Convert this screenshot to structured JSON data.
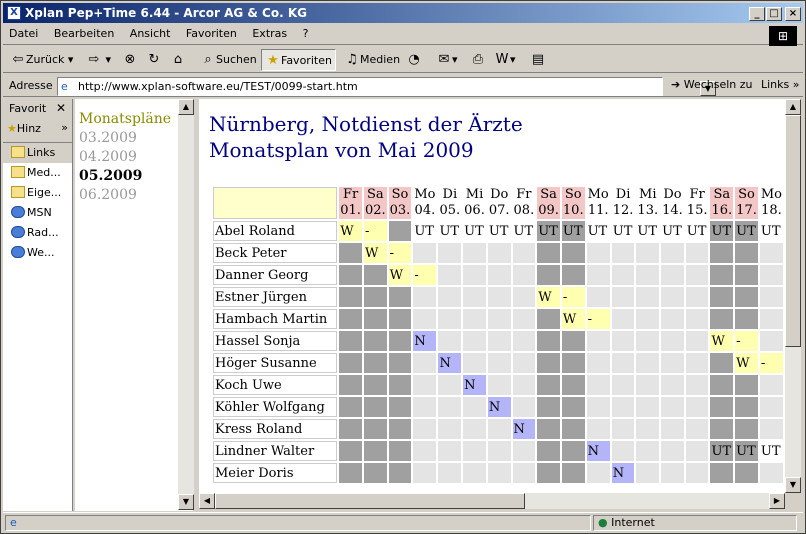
{
  "window": {
    "title": "Xplan Pep+Time 6.44 - Arcor AG & Co. KG"
  },
  "menu": [
    "Datei",
    "Bearbeiten",
    "Ansicht",
    "Favoriten",
    "Extras",
    "?"
  ],
  "toolbar": {
    "back": "Zurück",
    "search": "Suchen",
    "favorites": "Favoriten",
    "media": "Medien"
  },
  "address": {
    "label": "Adresse",
    "url": "http://www.xplan-software.eu/TEST/0099-start.htm",
    "go": "Wechseln zu",
    "links": "Links"
  },
  "favorites_pane": {
    "title": "Favorit",
    "add": "Hinz",
    "items": [
      "Links",
      "Med...",
      "Eige...",
      "MSN",
      "Rad...",
      "We..."
    ]
  },
  "left_nav": {
    "heading": "Monatspläne",
    "months": [
      "03.2009",
      "04.2009",
      "05.2009",
      "06.2009"
    ],
    "current": "05.2009"
  },
  "page": {
    "title_line1": "Nürnberg, Notdienst der Ärzte",
    "title_line2": "Monatsplan von Mai 2009"
  },
  "plan": {
    "weekdays": [
      "Fr",
      "Sa",
      "So",
      "Mo",
      "Di",
      "Mi",
      "Do",
      "Fr",
      "Sa",
      "So",
      "Mo",
      "Di",
      "Mi",
      "Do",
      "Fr",
      "Sa",
      "So",
      "Mo"
    ],
    "dates": [
      "01.",
      "02.",
      "03.",
      "04.",
      "05.",
      "06.",
      "07.",
      "08.",
      "09.",
      "10.",
      "11.",
      "12.",
      "13.",
      "14.",
      "15.",
      "16.",
      "17.",
      "18."
    ],
    "day_types": [
      "we",
      "we",
      "we",
      "wd",
      "wd",
      "wd",
      "wd",
      "wd",
      "we",
      "we",
      "wd",
      "wd",
      "wd",
      "wd",
      "wd",
      "we",
      "we",
      "wd"
    ],
    "rows": [
      {
        "name": "Abel Roland",
        "cells": [
          "W",
          "-",
          "",
          "UT",
          "UT",
          "UT",
          "UT",
          "UT",
          "UT",
          "UT",
          "UT",
          "UT",
          "UT",
          "UT",
          "UT",
          "UT",
          "UT",
          "UT"
        ],
        "classes": [
          "y",
          "y",
          "g",
          "ut",
          "ut",
          "ut",
          "ut",
          "ut",
          "g",
          "g",
          "ut",
          "ut",
          "ut",
          "ut",
          "ut",
          "g",
          "g",
          "ut"
        ]
      },
      {
        "name": "Beck Peter",
        "cells": [
          "",
          "W",
          "-",
          "",
          "",
          "",
          "",
          "",
          "",
          "",
          "",
          "",
          "",
          "",
          "",
          "",
          "",
          ""
        ],
        "classes": [
          "g",
          "y",
          "y",
          "l",
          "l",
          "l",
          "l",
          "l",
          "g",
          "g",
          "l",
          "l",
          "l",
          "l",
          "l",
          "g",
          "g",
          "l"
        ]
      },
      {
        "name": "Danner Georg",
        "cells": [
          "",
          "",
          "W",
          "-",
          "",
          "",
          "",
          "",
          "",
          "",
          "",
          "",
          "",
          "",
          "",
          "",
          "",
          ""
        ],
        "classes": [
          "g",
          "g",
          "y",
          "y",
          "l",
          "l",
          "l",
          "l",
          "g",
          "g",
          "l",
          "l",
          "l",
          "l",
          "l",
          "g",
          "g",
          "l"
        ]
      },
      {
        "name": "Estner Jürgen",
        "cells": [
          "",
          "",
          "",
          "",
          "",
          "",
          "",
          "",
          "W",
          "-",
          "",
          "",
          "",
          "",
          "",
          "",
          "",
          ""
        ],
        "classes": [
          "g",
          "g",
          "g",
          "l",
          "l",
          "l",
          "l",
          "l",
          "y",
          "y",
          "l",
          "l",
          "l",
          "l",
          "l",
          "g",
          "g",
          "l"
        ]
      },
      {
        "name": "Hambach Martin",
        "cells": [
          "",
          "",
          "",
          "",
          "",
          "",
          "",
          "",
          "",
          "W",
          "-",
          "",
          "",
          "",
          "",
          "",
          "",
          ""
        ],
        "classes": [
          "g",
          "g",
          "g",
          "l",
          "l",
          "l",
          "l",
          "l",
          "g",
          "y",
          "y",
          "l",
          "l",
          "l",
          "l",
          "g",
          "g",
          "l"
        ]
      },
      {
        "name": "Hassel Sonja",
        "cells": [
          "",
          "",
          "",
          "N",
          "",
          "",
          "",
          "",
          "",
          "",
          "",
          "",
          "",
          "",
          "",
          "W",
          "-",
          ""
        ],
        "classes": [
          "g",
          "g",
          "g",
          "b",
          "l",
          "l",
          "l",
          "l",
          "g",
          "g",
          "l",
          "l",
          "l",
          "l",
          "l",
          "y",
          "y",
          "l"
        ]
      },
      {
        "name": "Höger Susanne",
        "cells": [
          "",
          "",
          "",
          "",
          "N",
          "",
          "",
          "",
          "",
          "",
          "",
          "",
          "",
          "",
          "",
          "",
          "W",
          "-"
        ],
        "classes": [
          "g",
          "g",
          "g",
          "l",
          "b",
          "l",
          "l",
          "l",
          "g",
          "g",
          "l",
          "l",
          "l",
          "l",
          "l",
          "g",
          "y",
          "y"
        ]
      },
      {
        "name": "Koch Uwe",
        "cells": [
          "",
          "",
          "",
          "",
          "",
          "N",
          "",
          "",
          "",
          "",
          "",
          "",
          "",
          "",
          "",
          "",
          "",
          ""
        ],
        "classes": [
          "g",
          "g",
          "g",
          "l",
          "l",
          "b",
          "l",
          "l",
          "g",
          "g",
          "l",
          "l",
          "l",
          "l",
          "l",
          "g",
          "g",
          "l"
        ]
      },
      {
        "name": "Köhler Wolfgang",
        "cells": [
          "",
          "",
          "",
          "",
          "",
          "",
          "N",
          "",
          "",
          "",
          "",
          "",
          "",
          "",
          "",
          "",
          "",
          ""
        ],
        "classes": [
          "g",
          "g",
          "g",
          "l",
          "l",
          "l",
          "b",
          "l",
          "g",
          "g",
          "l",
          "l",
          "l",
          "l",
          "l",
          "g",
          "g",
          "l"
        ]
      },
      {
        "name": "Kress Roland",
        "cells": [
          "",
          "",
          "",
          "",
          "",
          "",
          "",
          "N",
          "",
          "",
          "",
          "",
          "",
          "",
          "",
          "",
          "",
          ""
        ],
        "classes": [
          "g",
          "g",
          "g",
          "l",
          "l",
          "l",
          "l",
          "b",
          "g",
          "g",
          "l",
          "l",
          "l",
          "l",
          "l",
          "g",
          "g",
          "l"
        ]
      },
      {
        "name": "Lindner Walter",
        "cells": [
          "",
          "",
          "",
          "",
          "",
          "",
          "",
          "",
          "",
          "",
          "N",
          "",
          "",
          "",
          "",
          "UT",
          "UT",
          "UT"
        ],
        "classes": [
          "g",
          "g",
          "g",
          "l",
          "l",
          "l",
          "l",
          "l",
          "g",
          "g",
          "b",
          "l",
          "l",
          "l",
          "l",
          "g",
          "g",
          "ut"
        ]
      },
      {
        "name": "Meier Doris",
        "cells": [
          "",
          "",
          "",
          "",
          "",
          "",
          "",
          "",
          "",
          "",
          "",
          "N",
          "",
          "",
          "",
          "",
          "",
          ""
        ],
        "classes": [
          "g",
          "g",
          "g",
          "l",
          "l",
          "l",
          "l",
          "l",
          "g",
          "g",
          "l",
          "b",
          "l",
          "l",
          "l",
          "g",
          "g",
          "l"
        ]
      }
    ]
  },
  "status": {
    "zone": "Internet"
  }
}
